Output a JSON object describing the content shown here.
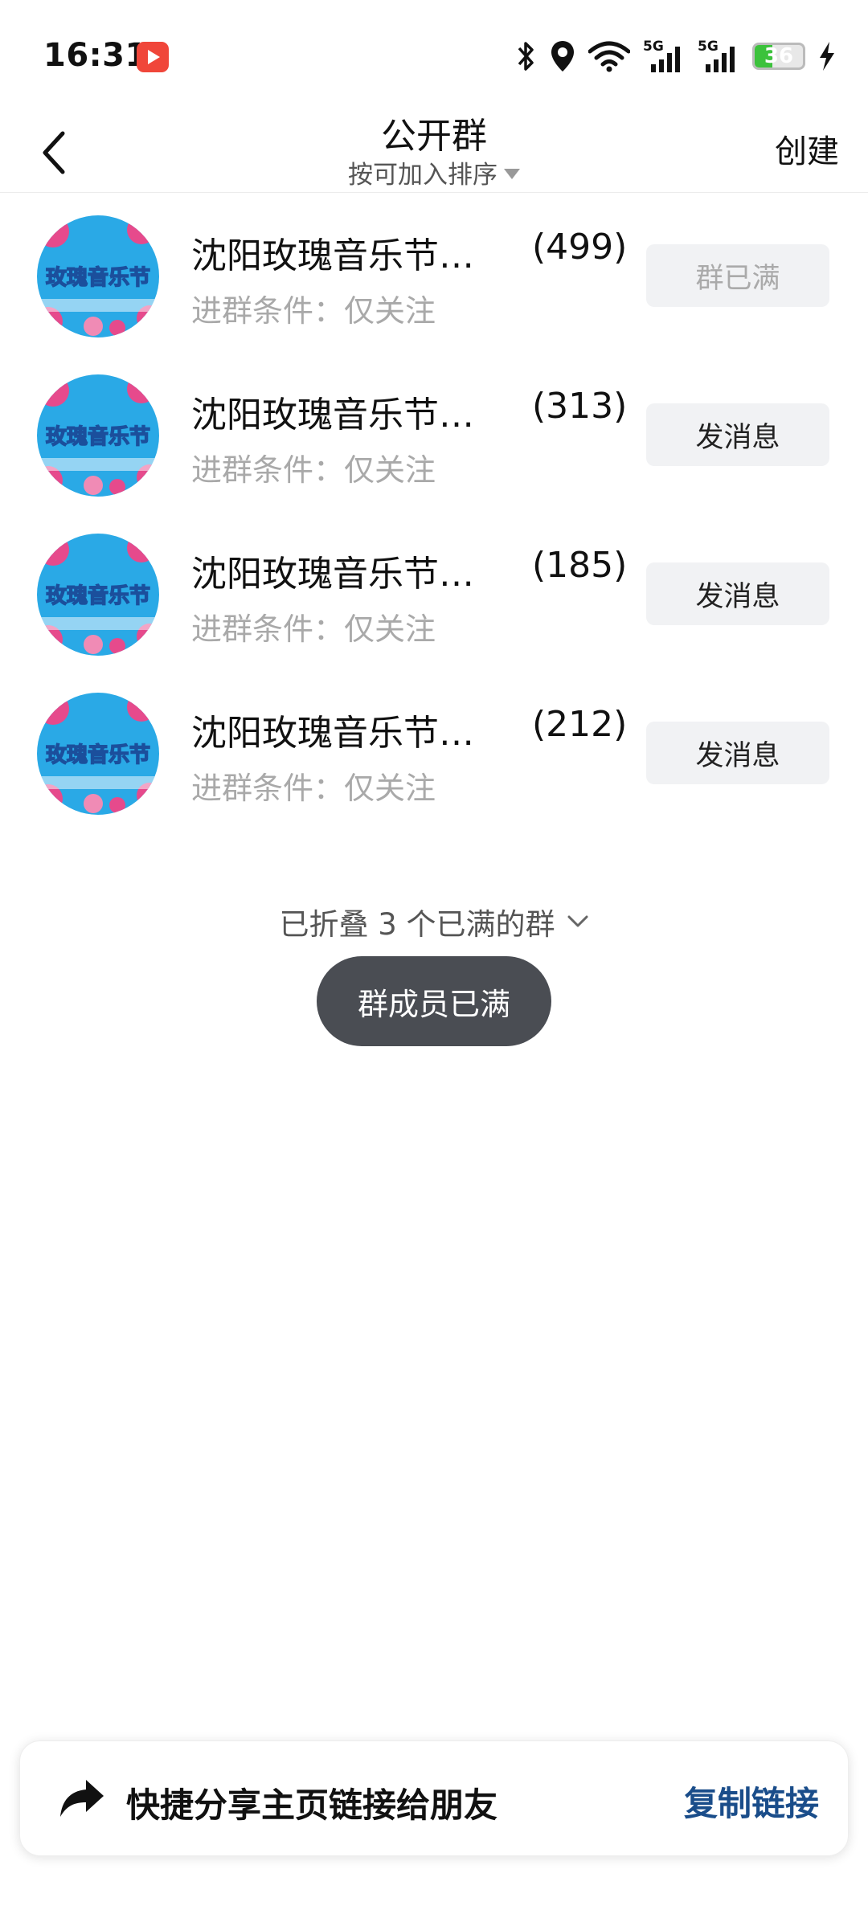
{
  "status_bar": {
    "time": "16:31",
    "signal_1_label": "5G",
    "signal_2_label": "5G",
    "battery_level": "36"
  },
  "header": {
    "title": "公开群",
    "sort_label": "按可加入排序",
    "create_label": "创建"
  },
  "groups": [
    {
      "name": "沈阳玫瑰音乐节闲…",
      "count": "(499)",
      "condition": "进群条件：仅关注",
      "action": "群已满",
      "avatar_text": "玫瑰音乐节"
    },
    {
      "name": "沈阳玫瑰音乐节闲…",
      "count": "(313)",
      "condition": "进群条件：仅关注",
      "action": "发消息",
      "avatar_text": "玫瑰音乐节"
    },
    {
      "name": "沈阳玫瑰音乐节闲…",
      "count": "(185)",
      "condition": "进群条件：仅关注",
      "action": "发消息",
      "avatar_text": "玫瑰音乐节"
    },
    {
      "name": "沈阳玫瑰音乐节闲…",
      "count": "(212)",
      "condition": "进群条件：仅关注",
      "action": "发消息",
      "avatar_text": "玫瑰音乐节"
    }
  ],
  "folded_label": "已折叠 3 个已满的群",
  "toast": "群成员已满",
  "share_bar": {
    "text": "快捷分享主页链接给朋友",
    "copy_label": "复制链接"
  },
  "colors": {
    "accent_link": "#1a4d8a",
    "toast_bg": "#4a4d53",
    "button_bg": "#f1f2f4"
  }
}
